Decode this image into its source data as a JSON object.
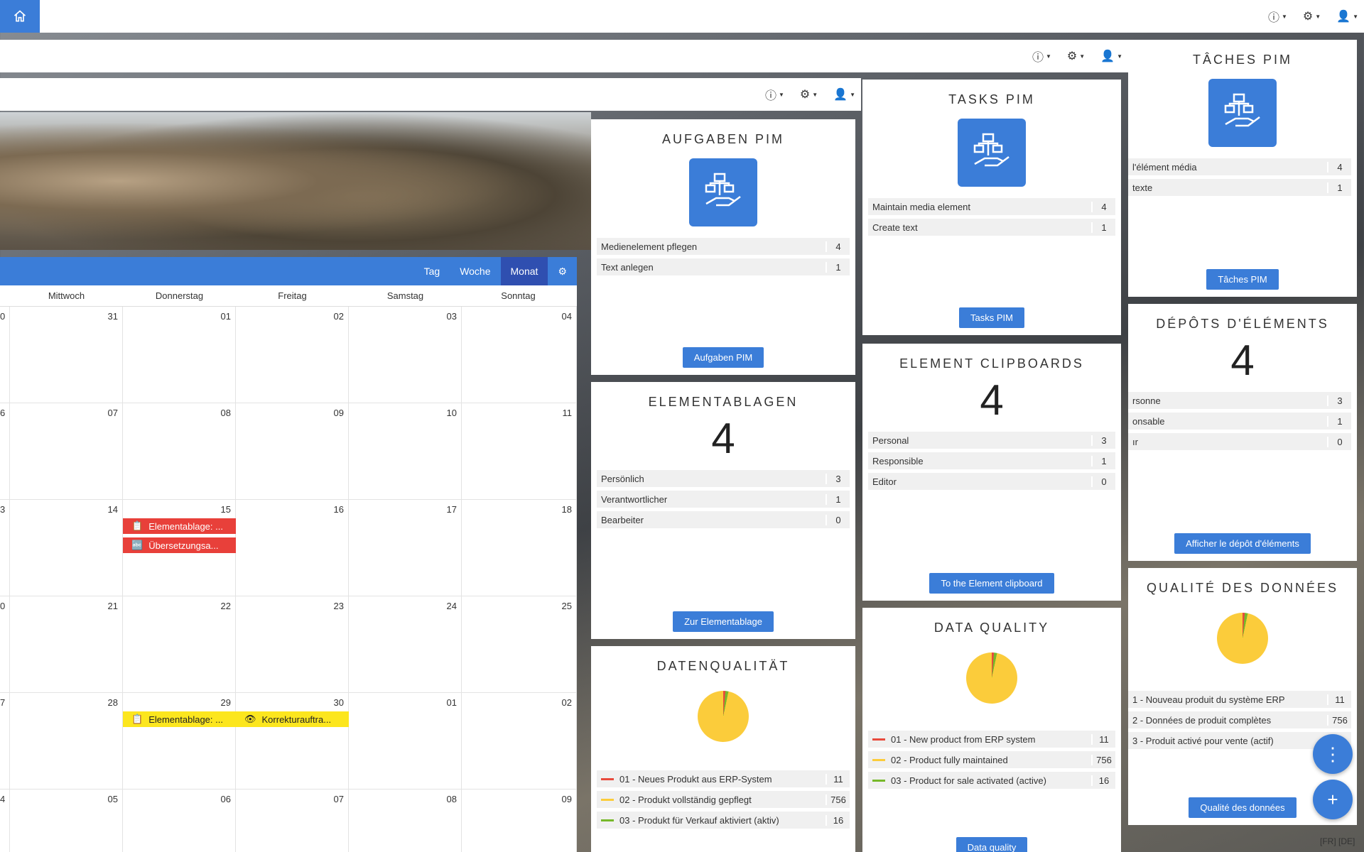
{
  "header": {
    "help": "?",
    "settings": "⚙",
    "user": "👤"
  },
  "calendar": {
    "views": [
      "Tag",
      "Woche",
      "Monat"
    ],
    "active_view": "Monat",
    "weekdays": [
      "Mittwoch",
      "Donnerstag",
      "Freitag",
      "Samstag",
      "Sonntag"
    ],
    "weeks": [
      [
        "0",
        "31",
        "01",
        "02",
        "03",
        "04"
      ],
      [
        "6",
        "07",
        "08",
        "09",
        "10",
        "11"
      ],
      [
        "3",
        "14",
        "15",
        "16",
        "17",
        "18"
      ],
      [
        "0",
        "21",
        "22",
        "23",
        "24",
        "25"
      ],
      [
        "7",
        "28",
        "29",
        "30",
        "01",
        "02"
      ],
      [
        "4",
        "05",
        "06",
        "07",
        "08",
        "09"
      ]
    ],
    "events": {
      "e1": "Elementablage: ...",
      "e2": "Übersetzungsa...",
      "e3": "Elementablage: ...",
      "e4": "Korrekturauftra..."
    }
  },
  "de": {
    "tasks": {
      "title": "AUFGABEN PIM",
      "rows": [
        [
          "Medienelement pflegen",
          "4"
        ],
        [
          "Text anlegen",
          "1"
        ]
      ],
      "button": "Aufgaben PIM"
    },
    "clip": {
      "title": "ELEMENTABLAGEN",
      "count": "4",
      "rows": [
        [
          "Persönlich",
          "3"
        ],
        [
          "Verantwortlicher",
          "1"
        ],
        [
          "Bearbeiter",
          "0"
        ]
      ],
      "button": "Zur Elementablage"
    },
    "quality": {
      "title": "DATENQUALITÄT",
      "rows": [
        [
          "01 - Neues Produkt aus ERP-System",
          "11"
        ],
        [
          "02 - Produkt vollständig gepflegt",
          "756"
        ],
        [
          "03 - Produkt für Verkauf aktiviert (aktiv)",
          "16"
        ]
      ]
    }
  },
  "en": {
    "tasks": {
      "title": "TASKS PIM",
      "rows": [
        [
          "Maintain media element",
          "4"
        ],
        [
          "Create text",
          "1"
        ]
      ],
      "button": "Tasks PIM"
    },
    "clip": {
      "title": "ELEMENT CLIPBOARDS",
      "count": "4",
      "rows": [
        [
          "Personal",
          "3"
        ],
        [
          "Responsible",
          "1"
        ],
        [
          "Editor",
          "0"
        ]
      ],
      "button": "To the Element clipboard"
    },
    "quality": {
      "title": "DATA QUALITY",
      "rows": [
        [
          "01 - New product from ERP system",
          "11"
        ],
        [
          "02 - Product fully maintained",
          "756"
        ],
        [
          "03 - Product for sale activated (active)",
          "16"
        ]
      ],
      "button": "Data quality"
    }
  },
  "fr": {
    "tasks": {
      "title": "TÂCHES PIM",
      "rows": [
        [
          "l'élément média",
          "4"
        ],
        [
          "texte",
          "1"
        ]
      ],
      "button": "Tâches PIM"
    },
    "clip": {
      "title": "DÉPÔTS D'ÉLÉMENTS",
      "count": "4",
      "rows": [
        [
          "rsonne",
          "3"
        ],
        [
          "onsable",
          "1"
        ],
        [
          "ır",
          "0"
        ]
      ],
      "button": "Afficher le dépôt d'éléments"
    },
    "quality": {
      "title": "QUALITÉ DES DONNÉES",
      "rows": [
        [
          "1 - Nouveau produit du système ERP",
          "11"
        ],
        [
          "2 - Données de produit complètes",
          "756"
        ],
        [
          "3 - Produit activé pour vente (actif)",
          ""
        ]
      ],
      "button": "Qualité des données"
    }
  },
  "colors": {
    "accent": "#3b7dd8",
    "red": "#e84a3c",
    "yellow": "#fbcc3b",
    "green": "#77b82a"
  },
  "footer": {
    "lang": "[FR] [DE]"
  },
  "fab": {
    "more": "⋮",
    "add": "+"
  }
}
